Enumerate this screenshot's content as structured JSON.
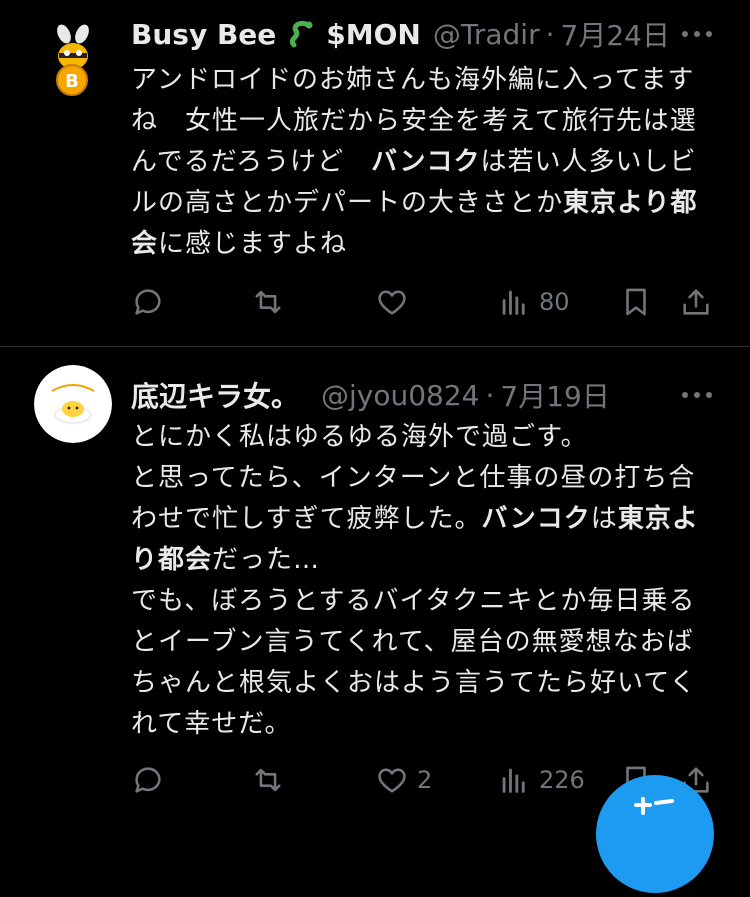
{
  "tweets": [
    {
      "name": "Busy Bee",
      "name_suffix": "$MON",
      "handle": "@Tradir",
      "separator": "·",
      "date": "7月24日",
      "body": [
        {
          "t": "アンドロイドのお姉さんも海外編に入ってますね　女性一人旅だから安全を考えて旅行先は選んでるだろうけど　"
        },
        {
          "t": "バンコク",
          "bold": true
        },
        {
          "t": "は若い人多いしビルの高さとかデパートの大きさとか"
        },
        {
          "t": "東京より都会",
          "bold": true
        },
        {
          "t": "に感じますよね"
        }
      ],
      "actions": {
        "reply": "",
        "retweet": "",
        "like": "",
        "views": "80"
      }
    },
    {
      "name": "底辺キラ女。",
      "handle": "@jyou0824",
      "separator": "·",
      "date": "7月19日",
      "body": [
        {
          "t": "とにかく私はゆるゆる海外で過ごす。\nと思ってたら、インターンと仕事の昼の打ち合わせで忙しすぎて疲弊した。"
        },
        {
          "t": "バンコク",
          "bold": true
        },
        {
          "t": "は"
        },
        {
          "t": "東京より都会",
          "bold": true
        },
        {
          "t": "だった…\nでも、ぼろうとするバイタクニキとか毎日乗るとイーブン言うてくれて、屋台の無愛想なおばちゃんと根気よくおはよう言うてたら好いてくれて幸せだ。"
        }
      ],
      "actions": {
        "reply": "",
        "retweet": "",
        "like": "2",
        "views": "226"
      }
    }
  ],
  "icons": {
    "emoji": "snake-emoji-icon",
    "more": "more-options-icon",
    "reply": "reply-icon",
    "retweet": "retweet-icon",
    "like": "heart-icon",
    "views": "views-icon",
    "bookmark": "bookmark-icon",
    "share": "share-icon",
    "compose": "compose-fab"
  },
  "colors": {
    "background": "#000000",
    "text": "#e7e9ea",
    "secondary": "#71767b",
    "divider": "#2f3336",
    "accent": "#1d9bf0",
    "bee": "#f5b800"
  }
}
